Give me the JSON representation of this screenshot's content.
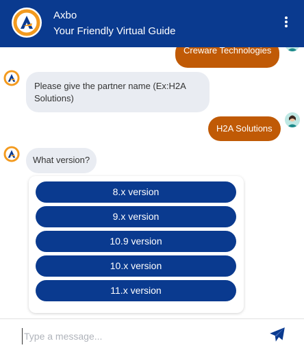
{
  "header": {
    "title": "Axbo",
    "subtitle": "Your Friendly Virtual Guide"
  },
  "messages": {
    "user_company": "Creware Technologies",
    "bot_partner_question": "Please give the partner name (Ex:H2A Solutions)",
    "user_partner": "H2A Solutions",
    "bot_version_question": "What version?"
  },
  "version_options": [
    "8.x version",
    "9.x version",
    "10.9 version",
    "10.x version",
    "11.x version"
  ],
  "composer": {
    "placeholder": "Type a message..."
  },
  "colors": {
    "brand_blue": "#0a3a8f",
    "user_bubble": "#c05a06",
    "bot_bubble": "#e9ecf2",
    "logo_orange": "#f39a1e"
  }
}
